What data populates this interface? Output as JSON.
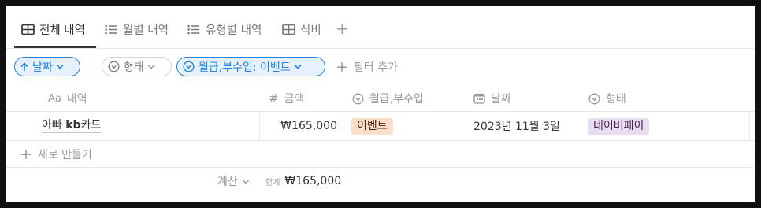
{
  "tabs": [
    {
      "label": "전체 내역",
      "icon": "table-icon",
      "active": true
    },
    {
      "label": "월별 내역",
      "icon": "list-icon",
      "active": false
    },
    {
      "label": "유형별 내역",
      "icon": "list-icon",
      "active": false
    },
    {
      "label": "식비",
      "icon": "table-icon",
      "active": false
    }
  ],
  "add_view": "+",
  "filters": {
    "sort_label": "날짜",
    "type_filter_label": "형태",
    "active_filter_label": "월급,부수입: 이벤트",
    "add_filter_label": "필터 추가"
  },
  "columns": {
    "name": {
      "icon": "Aa",
      "label": "내역"
    },
    "amount": {
      "icon": "#",
      "label": "금액"
    },
    "income": {
      "label": "월급,부수입"
    },
    "date": {
      "label": "날짜"
    },
    "type": {
      "label": "형태"
    }
  },
  "rows": [
    {
      "name_prefix": "아빠 ",
      "name_bold": "kb",
      "name_suffix": "카드",
      "amount": "₩165,000",
      "income": "이벤트",
      "date": "2023년 11월 3일",
      "type": "네이버페이"
    }
  ],
  "new_row_label": "새로 만들기",
  "calc": {
    "label": "계산",
    "sum_label": "합계",
    "sum_value": "₩165,000"
  },
  "colors": {
    "accent": "#2383e2",
    "tag_orange": "#fadec9",
    "tag_purple": "#e8deee"
  }
}
